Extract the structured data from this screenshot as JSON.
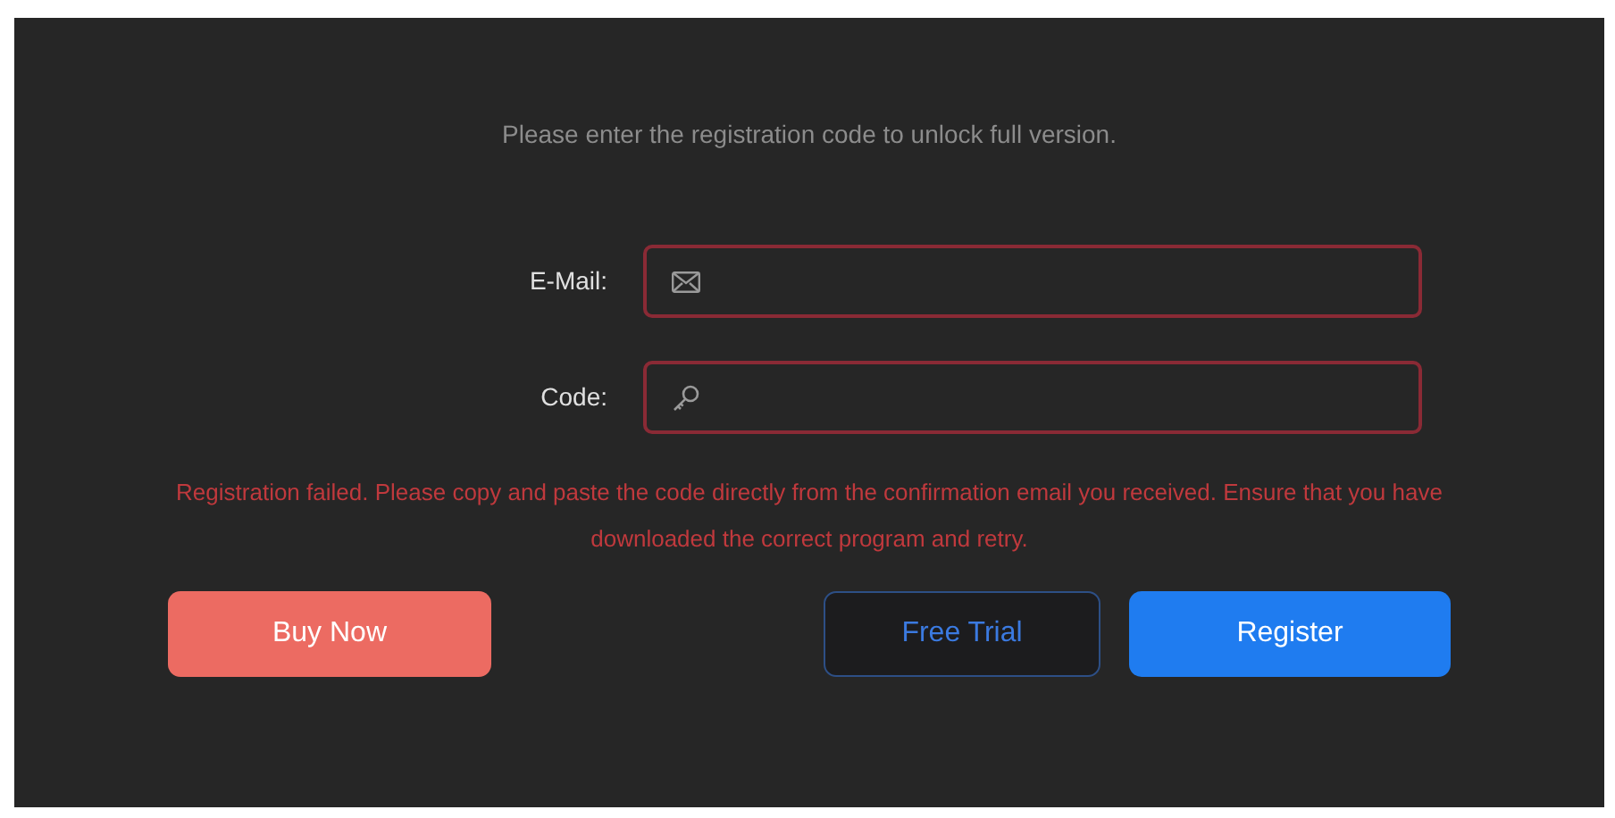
{
  "prompt": "Please enter the registration code to unlock full version.",
  "fields": [
    {
      "label": "E-Mail:",
      "kind": "email",
      "invalid": true
    },
    {
      "label": "Code:",
      "kind": "code",
      "invalid": true
    }
  ],
  "error": "Registration failed. Please copy and paste the code directly from the confirmation email you received. Ensure that you have downloaded the correct program and retry.",
  "buttons": [
    {
      "label": "Buy Now",
      "kind": "buy"
    },
    {
      "label": "Free Trial",
      "kind": "outline"
    },
    {
      "label": "Register",
      "kind": "primary"
    }
  ]
}
